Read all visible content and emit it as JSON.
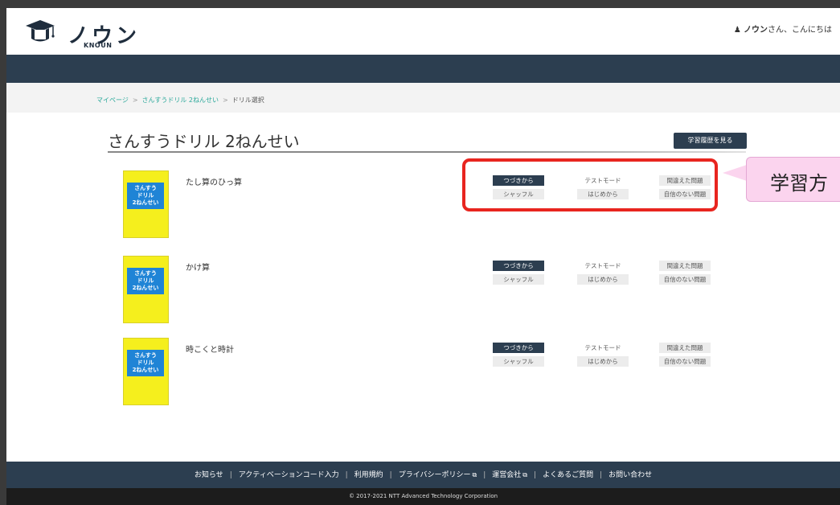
{
  "header": {
    "logo_text": "ノウン",
    "logo_sub": "KNOUN",
    "greeting_icon": "user-icon",
    "user_name": "ノウン",
    "greeting_suffix": "さん、こんにちは"
  },
  "breadcrumb": {
    "items": [
      "マイページ",
      "さんすうドリル 2ねんせい"
    ],
    "separator": ">",
    "current": "ドリル選択"
  },
  "page": {
    "title": "さんすうドリル 2ねんせい",
    "history_button": "学習履歴を見る"
  },
  "cover_text": [
    "さんすう",
    "ドリル",
    "2ねんせい"
  ],
  "drills": [
    {
      "name": "たし算のひっ算"
    },
    {
      "name": "かけ算"
    },
    {
      "name": "時こくと時計"
    }
  ],
  "modes": {
    "continue": "つづきから",
    "shuffle": "シャッフル",
    "test": "テストモード",
    "restart": "はじめから",
    "wrong": "間違えた問題",
    "unsure": "自信のない問題"
  },
  "callout": {
    "text": "学習方"
  },
  "footer": {
    "links": [
      "お知らせ",
      "アクティベーションコード入力",
      "利用規約",
      "プライバシーポリシー",
      "運営会社",
      "よくあるご質問",
      "お問い合わせ"
    ],
    "external_icon": "external-link-icon",
    "copyright": "© 2017-2021 NTT Advanced Technology Corporation"
  },
  "colors": {
    "navy": "#2c3e50",
    "teal_link": "#2aa89a",
    "cover_yellow": "#f5ef1d",
    "cover_blue": "#1f84d6",
    "highlight_red": "#e8251f",
    "callout_pink": "#fbd4ee"
  }
}
